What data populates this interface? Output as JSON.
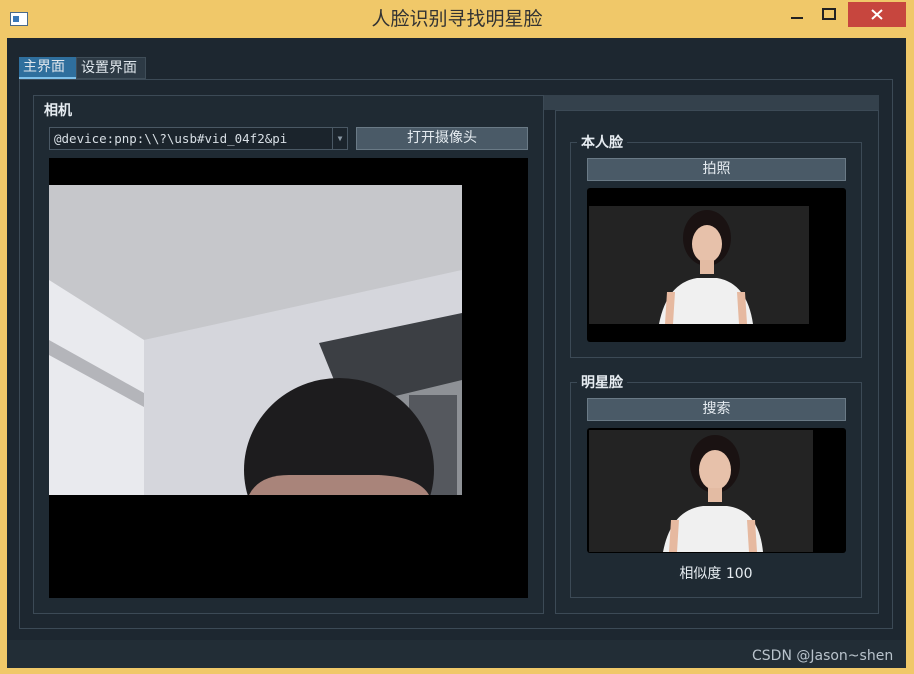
{
  "window": {
    "title": "人脸识别寻找明星脸",
    "icons": {
      "app": "app-window-icon",
      "minimize": "minimize-icon",
      "maximize": "maximize-icon",
      "close": "close-icon"
    }
  },
  "tabs": [
    {
      "label": "主界面",
      "selected": true
    },
    {
      "label": "设置界面",
      "selected": false
    }
  ],
  "camera": {
    "group_title": "相机",
    "device": "@device:pnp:\\\\?\\usb#vid_04f2&pi",
    "open_button": "打开摄像头"
  },
  "self_face": {
    "title": "本人脸",
    "capture_button": "拍照"
  },
  "star_face": {
    "title": "明星脸",
    "search_button": "搜索",
    "similarity_text": "相似度 100"
  },
  "watermark": "CSDN @Jason~shen",
  "colors": {
    "title_bar": "#f0c869",
    "close_button": "#c7463e",
    "background": "#1d2730",
    "tab_selected": "#2f6f9d",
    "button": "#4a5a67"
  }
}
